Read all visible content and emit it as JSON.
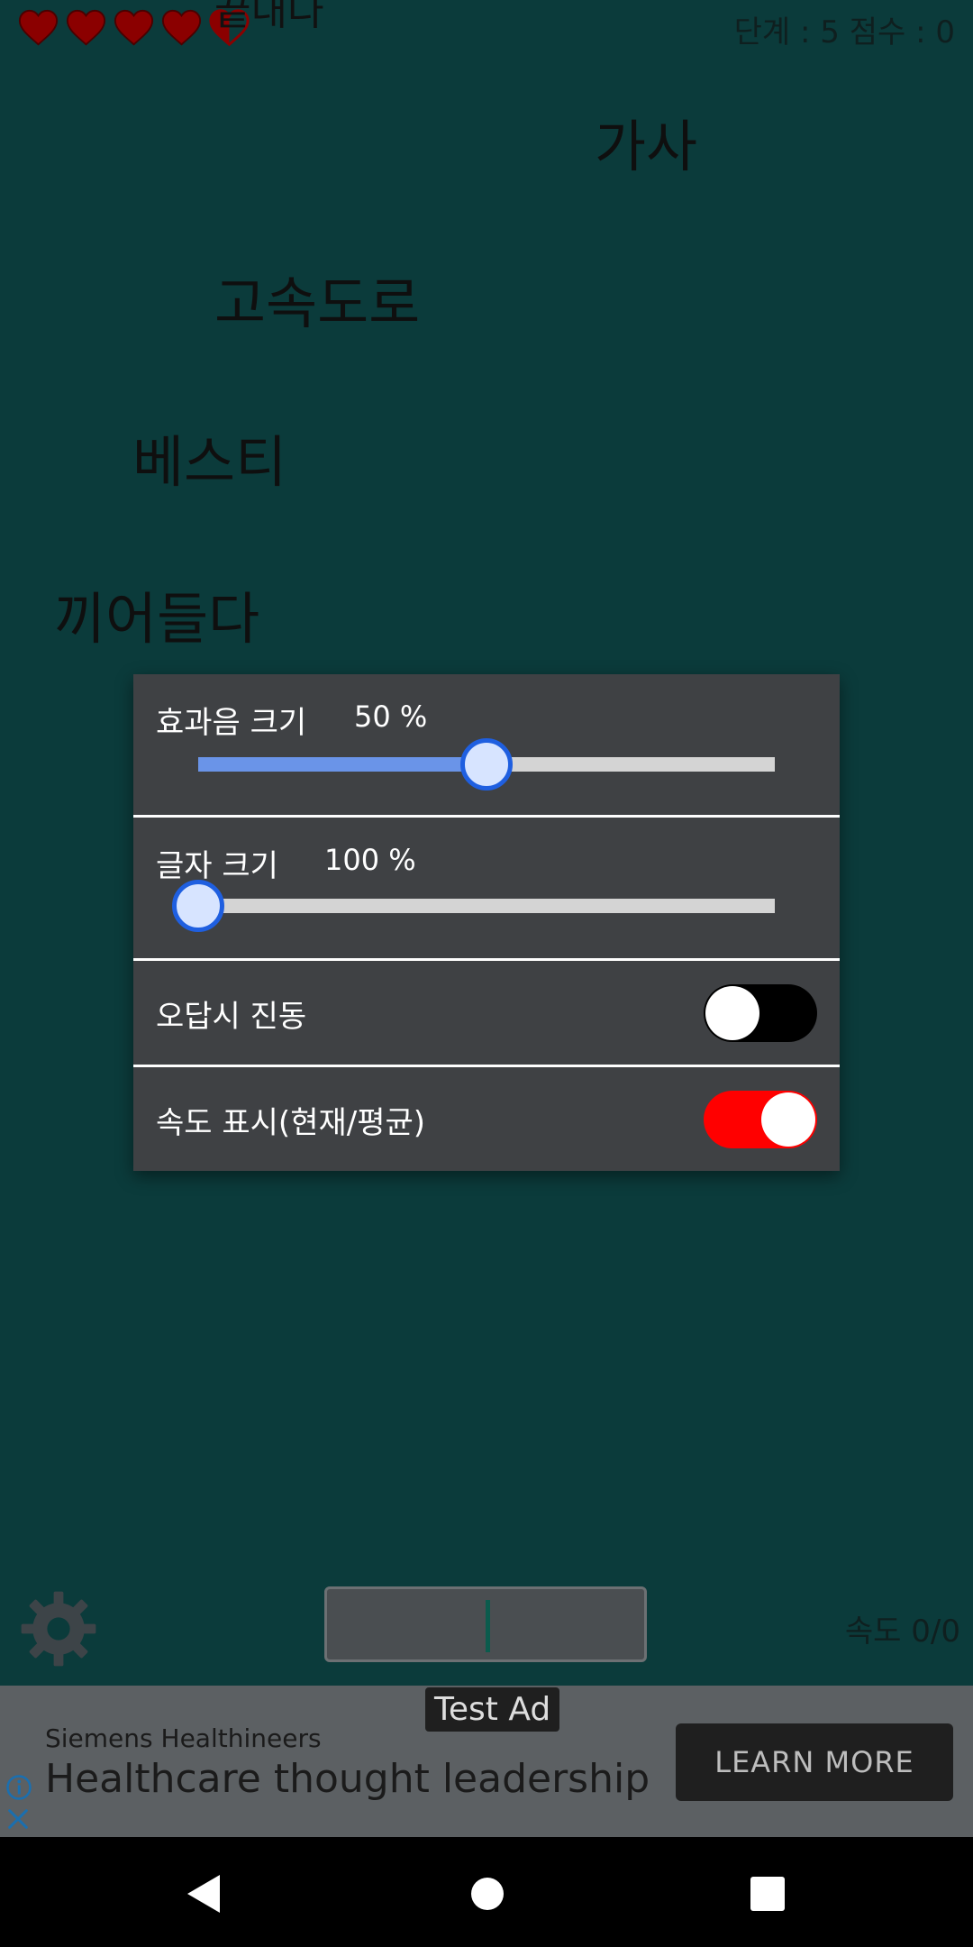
{
  "hud": {
    "hearts": [
      "full",
      "full",
      "full",
      "full",
      "half"
    ],
    "score_text": "단계 : 5 점수 : 0",
    "top_word_partial": "끝내다"
  },
  "falling_words": [
    "가사",
    "고속도로",
    "베스티",
    "끼어들다"
  ],
  "settings": {
    "sfx_label": "효과음 크기",
    "sfx_value": "50 %",
    "sfx_level": 0.5,
    "text_size_label": "글자 크기",
    "text_size_value": "100 %",
    "text_size_level": 0.0,
    "vibrate_label": "오답시 진동",
    "vibrate_on": false,
    "speed_display_label": "속도 표시(현재/평균)",
    "speed_display_on": true
  },
  "bottom": {
    "speed_text": "속도 0/0",
    "gear_icon": "gear-icon"
  },
  "ad": {
    "tag": "Test Ad",
    "brand": "Siemens Healthineers",
    "headline": "Healthcare thought leadership",
    "cta": "LEARN MORE"
  },
  "colors": {
    "background": "#0b3b3b",
    "dialog": "#3f4144",
    "slider_thumb_border": "#1f5fe0",
    "switch_on": "#ff0000",
    "heart": "#8b0000"
  }
}
